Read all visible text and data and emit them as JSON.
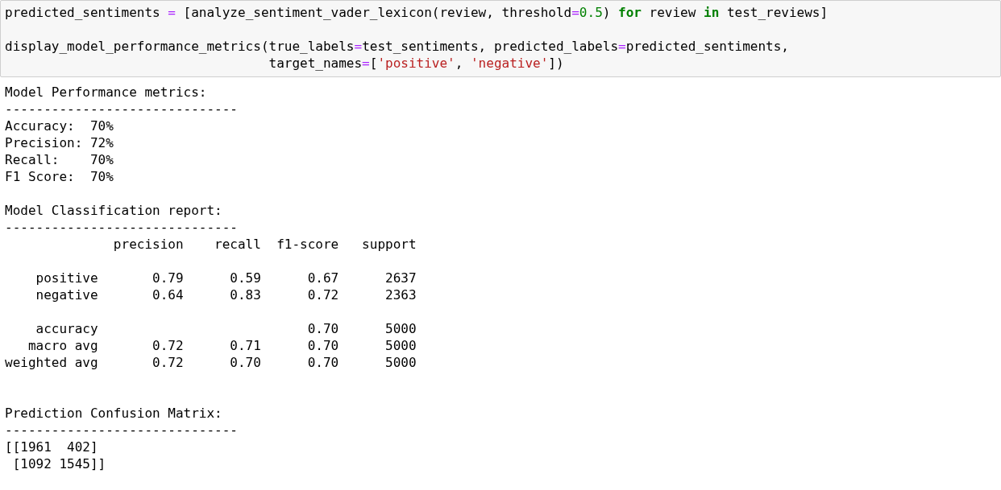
{
  "code_cell": {
    "lines": [
      {
        "kind": "code",
        "tokens": [
          {
            "kind": "plain",
            "text": "predicted_sentiments "
          },
          {
            "kind": "operator",
            "text": "="
          },
          {
            "kind": "plain",
            "text": " [analyze_sentiment_vader_lexicon(review, threshold"
          },
          {
            "kind": "operator",
            "text": "="
          },
          {
            "kind": "number",
            "text": "0.5"
          },
          {
            "kind": "plain",
            "text": ") "
          },
          {
            "kind": "keyword",
            "text": "for"
          },
          {
            "kind": "plain",
            "text": " review "
          },
          {
            "kind": "keyword",
            "text": "in"
          },
          {
            "kind": "plain",
            "text": " test_reviews]"
          }
        ]
      },
      {
        "kind": "blank"
      },
      {
        "kind": "code",
        "tokens": [
          {
            "kind": "plain",
            "text": "display_model_performance_metrics(true_labels"
          },
          {
            "kind": "operator",
            "text": "="
          },
          {
            "kind": "plain",
            "text": "test_sentiments, predicted_labels"
          },
          {
            "kind": "operator",
            "text": "="
          },
          {
            "kind": "plain",
            "text": "predicted_sentiments,"
          }
        ]
      },
      {
        "kind": "code",
        "tokens": [
          {
            "kind": "plain",
            "text": "                                  target_names"
          },
          {
            "kind": "operator",
            "text": "="
          },
          {
            "kind": "plain",
            "text": "["
          },
          {
            "kind": "string",
            "text": "'positive'"
          },
          {
            "kind": "plain",
            "text": ", "
          },
          {
            "kind": "string",
            "text": "'negative'"
          },
          {
            "kind": "plain",
            "text": "])"
          }
        ]
      }
    ]
  },
  "output": {
    "lines": [
      {
        "kind": "text",
        "text": "Model Performance metrics:"
      },
      {
        "kind": "text",
        "text": "------------------------------"
      },
      {
        "kind": "text",
        "text": "Accuracy:  70%"
      },
      {
        "kind": "text",
        "text": "Precision: 72%"
      },
      {
        "kind": "text",
        "text": "Recall:    70%"
      },
      {
        "kind": "text",
        "text": "F1 Score:  70%"
      },
      {
        "kind": "blank"
      },
      {
        "kind": "text",
        "text": "Model Classification report:"
      },
      {
        "kind": "text",
        "text": "------------------------------"
      },
      {
        "kind": "text",
        "text": "              precision    recall  f1-score   support"
      },
      {
        "kind": "blank"
      },
      {
        "kind": "text",
        "text": "    positive       0.79      0.59      0.67      2637"
      },
      {
        "kind": "text",
        "text": "    negative       0.64      0.83      0.72      2363"
      },
      {
        "kind": "blank"
      },
      {
        "kind": "text",
        "text": "    accuracy                           0.70      5000"
      },
      {
        "kind": "text",
        "text": "   macro avg       0.72      0.71      0.70      5000"
      },
      {
        "kind": "text",
        "text": "weighted avg       0.72      0.70      0.70      5000"
      },
      {
        "kind": "blank"
      },
      {
        "kind": "blank"
      },
      {
        "kind": "text",
        "text": "Prediction Confusion Matrix:"
      },
      {
        "kind": "text",
        "text": "------------------------------"
      },
      {
        "kind": "text",
        "text": "[[1961  402]"
      },
      {
        "kind": "text",
        "text": " [1092 1545]]"
      }
    ]
  }
}
